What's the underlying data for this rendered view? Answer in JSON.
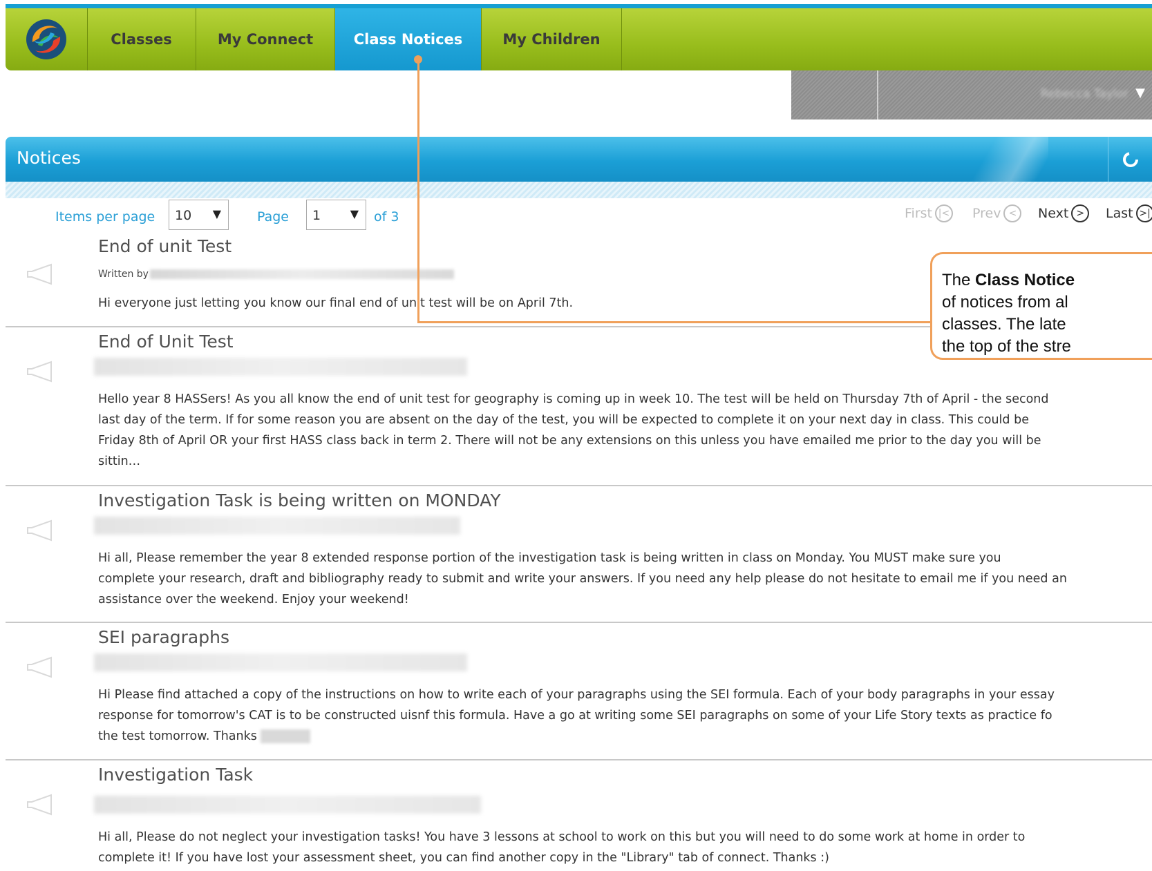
{
  "nav": {
    "tabs": [
      {
        "label": "Classes"
      },
      {
        "label": "My Connect"
      },
      {
        "label": "Class Notices"
      },
      {
        "label": "My Children"
      }
    ],
    "active_tab": "Class Notices"
  },
  "user": {
    "name": "Rebecca Taylor"
  },
  "panel": {
    "title": "Notices"
  },
  "pagination": {
    "items_per_page_label": "Items per page",
    "items_per_page_value": "10",
    "page_label": "Page",
    "page_value": "1",
    "of_label": "of 3",
    "first": "First",
    "prev": "Prev",
    "next": "Next",
    "last": "Last"
  },
  "notices": [
    {
      "title": "End of unit Test",
      "byline_prefix": "Written by",
      "body": [
        "Hi everyone just letting you know our final end of unit test will be on April 7th."
      ]
    },
    {
      "title": "End of Unit Test",
      "body": [
        "Hello year 8 HASSers! As you all know the end of unit test for geography is coming up in week 10. The test will be held on Thursday 7th of April - the second",
        "last day of the term. If for some reason you are absent on the day of the test, you will be expected to complete it on your next day in class. This could be",
        "Friday 8th of April OR your first HASS class back in term 2. There will not be any extensions on this unless you have emailed me prior to the day you will be",
        "sittin…"
      ]
    },
    {
      "title": "Investigation Task is being written on MONDAY",
      "body": [
        "Hi all, Please remember the year 8 extended response portion of the investigation task is being written in class on Monday. You MUST make sure you",
        "complete your research, draft and bibliography ready to submit and write your answers. If you need any help please do not hesitate to email me if you need an",
        "assistance over the weekend. Enjoy your weekend!"
      ]
    },
    {
      "title": "SEI paragraphs",
      "body": [
        "Hi Please find attached a copy of the instructions on how to write each of your paragraphs using the SEI formula. Each of your body paragraphs in your essay",
        "response for tomorrow's CAT is to be constructed uisnf this formula. Have a go at writing some SEI paragraphs on some of your Life Story texts as practice fo",
        "the test tomorrow. Thanks"
      ]
    },
    {
      "title": "Investigation Task",
      "body": [
        "Hi all, Please do not neglect your investigation tasks! You have 3 lessons at school to work on this but you will need to do some work at home in order to",
        "complete it! If you have lost your assessment sheet, you can find another copy in the \"Library\" tab of connect. Thanks :)"
      ]
    }
  ],
  "callout": {
    "line1_pre": "The ",
    "line1_bold": "Class Notice",
    "line2": "of notices from al",
    "line3": "classes.  The late",
    "line4": "the top of the stre"
  },
  "colors": {
    "nav_green": "#98bd1c",
    "active_blue": "#1b9fd6",
    "link_blue": "#2a9fd6",
    "callout_orange": "#f0a05a"
  }
}
